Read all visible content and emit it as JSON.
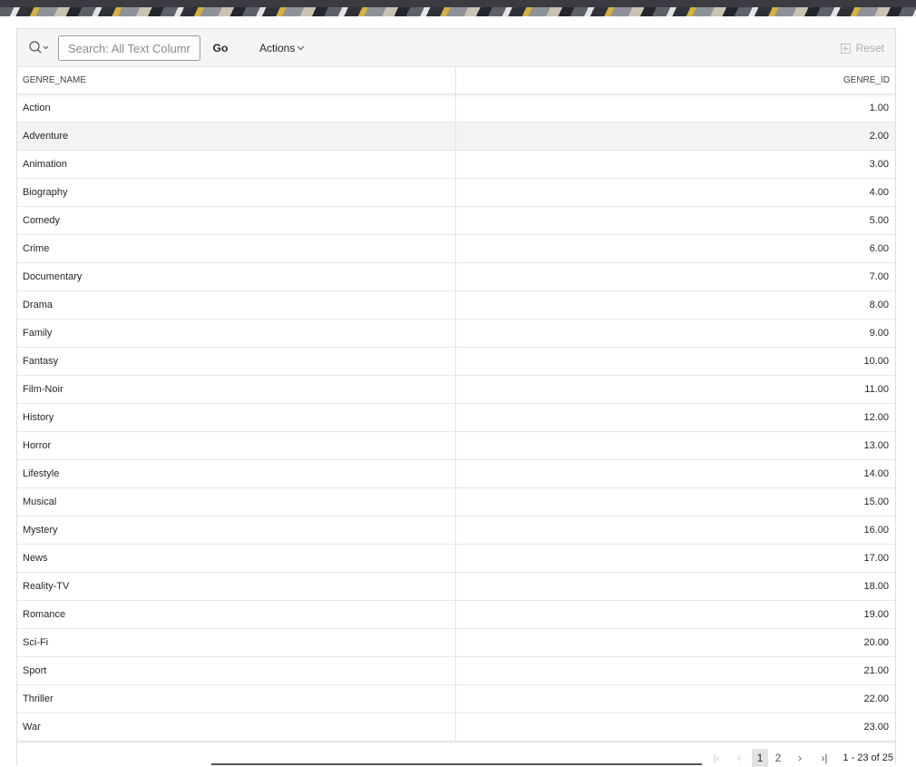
{
  "toolbar": {
    "search_placeholder": "Search: All Text Columns",
    "search_value": "",
    "go_label": "Go",
    "actions_label": "Actions",
    "reset_label": "Reset"
  },
  "columns": [
    "GENRE_NAME",
    "GENRE_ID"
  ],
  "rows": [
    {
      "name": "Action",
      "id": "1.00"
    },
    {
      "name": "Adventure",
      "id": "2.00"
    },
    {
      "name": "Animation",
      "id": "3.00"
    },
    {
      "name": "Biography",
      "id": "4.00"
    },
    {
      "name": "Comedy",
      "id": "5.00"
    },
    {
      "name": "Crime",
      "id": "6.00"
    },
    {
      "name": "Documentary",
      "id": "7.00"
    },
    {
      "name": "Drama",
      "id": "8.00"
    },
    {
      "name": "Family",
      "id": "9.00"
    },
    {
      "name": "Fantasy",
      "id": "10.00"
    },
    {
      "name": "Film-Noir",
      "id": "11.00"
    },
    {
      "name": "History",
      "id": "12.00"
    },
    {
      "name": "Horror",
      "id": "13.00"
    },
    {
      "name": "Lifestyle",
      "id": "14.00"
    },
    {
      "name": "Musical",
      "id": "15.00"
    },
    {
      "name": "Mystery",
      "id": "16.00"
    },
    {
      "name": "News",
      "id": "17.00"
    },
    {
      "name": "Reality-TV",
      "id": "18.00"
    },
    {
      "name": "Romance",
      "id": "19.00"
    },
    {
      "name": "Sci-Fi",
      "id": "20.00"
    },
    {
      "name": "Sport",
      "id": "21.00"
    },
    {
      "name": "Thriller",
      "id": "22.00"
    },
    {
      "name": "War",
      "id": "23.00"
    }
  ],
  "hovered_row": 1,
  "pagination": {
    "first": "|‹",
    "prev": "‹",
    "pages": [
      "1",
      "2"
    ],
    "current_page": "1",
    "next": "›",
    "last": "›|",
    "range_label": "1 - 23 of 25"
  },
  "icons": {
    "search": "search-icon",
    "chevron": "chevron-down-icon",
    "reset": "reset-icon"
  }
}
